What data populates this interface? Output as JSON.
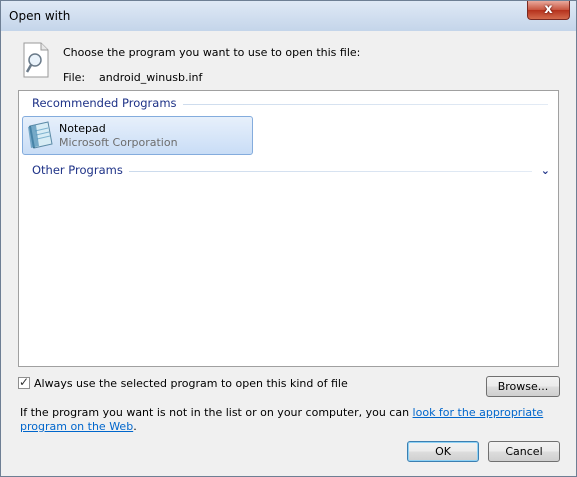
{
  "window": {
    "title": "Open with",
    "close_label": "x"
  },
  "header": {
    "prompt": "Choose the program you want to use to open this file:",
    "file_label": "File:",
    "file_name": "android_winusb.inf"
  },
  "groups": {
    "recommended": {
      "title": "Recommended Programs",
      "items": [
        {
          "name": "Notepad",
          "publisher": "Microsoft Corporation",
          "icon": "notepad-icon",
          "selected": true
        }
      ]
    },
    "other": {
      "title": "Other Programs",
      "expander": "⌄"
    }
  },
  "options": {
    "always_use_label": "Always use the selected program to open this kind of file",
    "always_use_checked": true,
    "check_glyph": "✓"
  },
  "buttons": {
    "browse": "Browse...",
    "ok": "OK",
    "cancel": "Cancel"
  },
  "help": {
    "text_before": "If the program you want is not in the list or on your computer, you can ",
    "link": "look for the appropriate program on the Web",
    "text_after": "."
  },
  "colors": {
    "group_title": "#1e3287",
    "link": "#0066cc",
    "selection": "#c9ddf6",
    "close_button": "#c7543e"
  }
}
